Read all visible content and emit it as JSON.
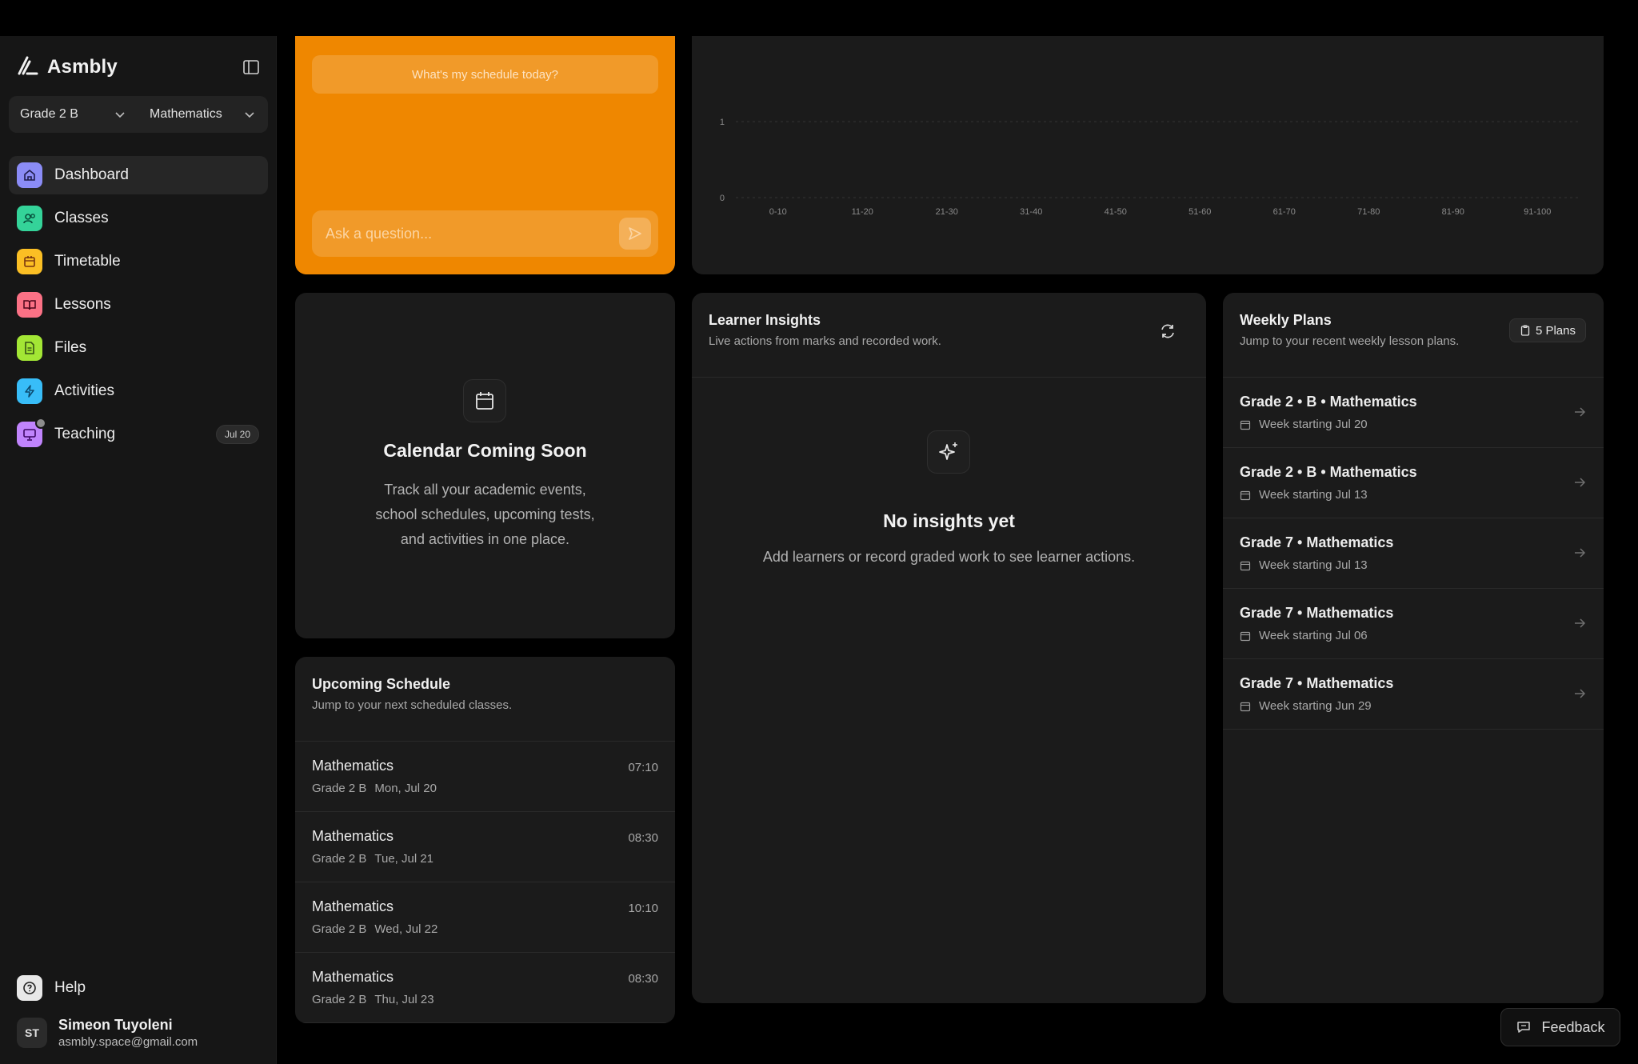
{
  "app": {
    "name": "Asmbly"
  },
  "selectors": {
    "grade": "Grade 2 B",
    "subject": "Mathematics"
  },
  "nav": [
    {
      "label": "Dashboard",
      "icon": "home-icon",
      "color": "#8b8cf6",
      "active": true
    },
    {
      "label": "Classes",
      "icon": "users-icon",
      "color": "#34d399"
    },
    {
      "label": "Timetable",
      "icon": "calendar-icon",
      "color": "#fbbf24"
    },
    {
      "label": "Lessons",
      "icon": "book-open-icon",
      "color": "#fb7185"
    },
    {
      "label": "Files",
      "icon": "file-icon",
      "color": "#a3e635"
    },
    {
      "label": "Activities",
      "icon": "bolt-icon",
      "color": "#38bdf8"
    },
    {
      "label": "Teaching",
      "icon": "presentation-icon",
      "color": "#c084fc",
      "badge": "Jul 20"
    }
  ],
  "help": {
    "label": "Help"
  },
  "user": {
    "initials": "ST",
    "name": "Simeon Tuyoleni",
    "email": "asmbly.space@gmail.com"
  },
  "assistant": {
    "suggestion": "What's my schedule today?",
    "placeholder": "Ask a question..."
  },
  "chart_data": {
    "type": "bar",
    "categories": [
      "0-10",
      "11-20",
      "21-30",
      "31-40",
      "41-50",
      "51-60",
      "61-70",
      "71-80",
      "81-90",
      "91-100"
    ],
    "values": [
      0,
      0,
      0,
      0,
      0,
      0,
      0,
      0,
      0,
      0
    ],
    "yticks": [
      "1",
      "0"
    ],
    "ylim": [
      0,
      1
    ],
    "grid": true
  },
  "calendar": {
    "title": "Calendar Coming Soon",
    "text": "Track all your academic events, school schedules, upcoming tests, and activities in one place."
  },
  "schedule": {
    "title": "Upcoming Schedule",
    "subtitle": "Jump to your next scheduled classes.",
    "rows": [
      {
        "subject": "Mathematics",
        "class": "Grade 2 B",
        "date": "Mon, Jul 20",
        "time": "07:10"
      },
      {
        "subject": "Mathematics",
        "class": "Grade 2 B",
        "date": "Tue, Jul 21",
        "time": "08:30"
      },
      {
        "subject": "Mathematics",
        "class": "Grade 2 B",
        "date": "Wed, Jul 22",
        "time": "10:10"
      },
      {
        "subject": "Mathematics",
        "class": "Grade 2 B",
        "date": "Thu, Jul 23",
        "time": "08:30"
      }
    ]
  },
  "insights": {
    "title": "Learner Insights",
    "subtitle": "Live actions from marks and recorded work.",
    "empty_title": "No insights yet",
    "empty_text": "Add learners or record graded work to see learner actions."
  },
  "plans": {
    "title": "Weekly Plans",
    "subtitle": "Jump to your recent weekly lesson plans.",
    "badge": "5 Plans",
    "rows": [
      {
        "title": "Grade 2 • B • Mathematics",
        "week": "Week starting Jul 20"
      },
      {
        "title": "Grade 2 • B • Mathematics",
        "week": "Week starting Jul 13"
      },
      {
        "title": "Grade 7 • Mathematics",
        "week": "Week starting Jul 13"
      },
      {
        "title": "Grade 7 • Mathematics",
        "week": "Week starting Jul 06"
      },
      {
        "title": "Grade 7 • Mathematics",
        "week": "Week starting Jun 29"
      }
    ]
  },
  "feedback": {
    "label": "Feedback"
  }
}
